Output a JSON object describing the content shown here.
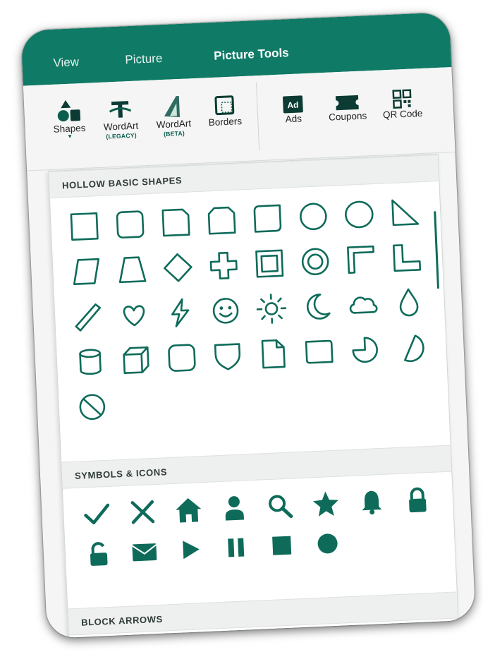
{
  "tabs": [
    {
      "label": "View",
      "active": false
    },
    {
      "label": "Picture",
      "active": false
    },
    {
      "label": "Picture Tools",
      "active": true
    }
  ],
  "ribbon": {
    "shapes": {
      "label": "Shapes"
    },
    "wordart_legacy": {
      "label": "WordArt",
      "sub": "(LEGACY)"
    },
    "wordart_beta": {
      "label": "WordArt",
      "sub": "(BETA)"
    },
    "borders": {
      "label": "Borders"
    },
    "ads": {
      "label": "Ads"
    },
    "coupons": {
      "label": "Coupons"
    },
    "qr_code": {
      "label": "QR Code"
    }
  },
  "panel": {
    "sections": [
      {
        "title": "HOLLOW BASIC SHAPES"
      },
      {
        "title": "SYMBOLS & ICONS"
      },
      {
        "title": "BLOCK ARROWS"
      }
    ],
    "hollow_shapes": [
      "square-icon",
      "rounded-square-icon",
      "snipped-corner-square-icon",
      "snipped-two-corners-square-icon",
      "rounded-corner-square-icon",
      "circle-icon",
      "ellipse-icon",
      "right-triangle-icon",
      "parallelogram-icon",
      "trapezoid-icon",
      "diamond-icon",
      "plus-shape-icon",
      "frame-icon",
      "donut-icon",
      "half-frame-icon",
      "l-shape-icon",
      "diagonal-stripe-icon",
      "heart-icon",
      "lightning-icon",
      "smiley-icon",
      "sun-icon",
      "moon-icon",
      "cloud-icon",
      "teardrop-icon",
      "cylinder-icon",
      "cube-icon",
      "bevel-icon",
      "shield-icon",
      "folded-corner-icon",
      "plaque-icon",
      "pie-icon",
      "chord-icon",
      "no-symbol-icon"
    ],
    "symbols": [
      "checkmark-icon",
      "x-icon",
      "home-icon",
      "person-icon",
      "magnifier-icon",
      "star-icon",
      "bell-icon",
      "lock-icon",
      "unlock-icon",
      "envelope-icon",
      "play-icon",
      "pause-icon",
      "stop-icon",
      "record-circle-icon"
    ]
  },
  "colors": {
    "accent": "#0f7a66",
    "shape_stroke": "#0e6b5a"
  }
}
